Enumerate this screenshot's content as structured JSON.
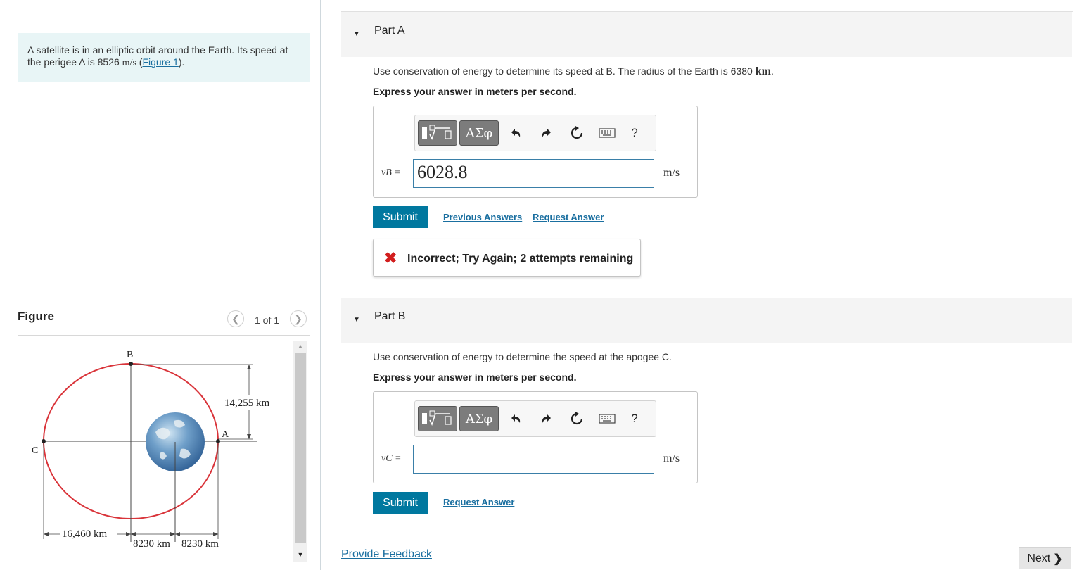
{
  "problem": {
    "text_before": "A satellite is in an elliptic orbit around the Earth. Its speed at the perigee A is 8526 ",
    "unit": "m/s",
    "link_text": "Figure 1",
    "text_after": "."
  },
  "figure": {
    "title": "Figure",
    "counter": "1 of 1",
    "prev_icon": "chevron-left-icon",
    "next_icon": "chevron-right-icon",
    "labels": {
      "B": "B",
      "A": "A",
      "C": "C",
      "dim_vertical": "14,255 km",
      "dim_left": "16,460 km",
      "dim_mid1": "8230 km",
      "dim_mid2": "8230 km"
    },
    "colors": {
      "orbit": "#d9343a",
      "earth": "#3a78b8"
    }
  },
  "partA": {
    "title": "Part A",
    "question": "Use conservation of energy to determine its speed at B. The radius of the Earth is 6380 ",
    "question_unit": "km",
    "question_end": ".",
    "instruction": "Express your answer in meters per second.",
    "answer_label": "vB =",
    "answer_value": "6028.8",
    "unit": "m/s",
    "submit": "Submit",
    "link_previous": "Previous Answers",
    "link_request": "Request Answer",
    "feedback": "Incorrect; Try Again; 2 attempts remaining"
  },
  "partB": {
    "title": "Part B",
    "question": "Use conservation of energy to determine the speed at the apogee C.",
    "instruction": "Express your answer in meters per second.",
    "answer_label": "vC =",
    "answer_value": "",
    "unit": "m/s",
    "submit": "Submit",
    "link_request": "Request Answer"
  },
  "toolbar": {
    "greek": "ΑΣφ",
    "help": "?",
    "icons": [
      "templates-icon",
      "greek-letters-icon",
      "undo-icon",
      "redo-icon",
      "reset-icon",
      "keyboard-icon",
      "help-icon"
    ]
  },
  "footer": {
    "provide_feedback": "Provide Feedback",
    "next": "Next",
    "next_icon": "chevron-right-icon"
  },
  "colors": {
    "accent": "#00789f",
    "link": "#1a6fa0",
    "error": "#d21e1e",
    "problem_bg": "#e8f5f6"
  }
}
